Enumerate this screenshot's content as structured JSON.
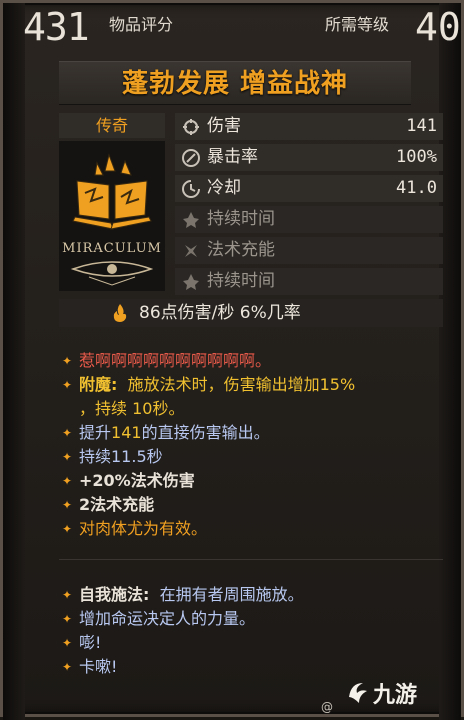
{
  "header": {
    "item_score": "431",
    "item_score_label": "物品评分",
    "required_level_label": "所需等级",
    "required_level": "40"
  },
  "item": {
    "name": "蓬勃发展 增益战神",
    "rarity": "传奇",
    "icon": "spellbook-icon",
    "emblem_text": "MIRACULUM"
  },
  "stats": [
    {
      "icon": "damage-icon",
      "name": "伤害",
      "value": "141"
    },
    {
      "icon": "crit-icon",
      "name": "暴击率",
      "value": "100%"
    },
    {
      "icon": "cooldown-icon",
      "name": "冷却",
      "value": "41.0"
    },
    {
      "icon": "duration-icon",
      "name": "持续时间",
      "value": ""
    },
    {
      "icon": "charges-icon",
      "name": "法术充能",
      "value": ""
    },
    {
      "icon": "duration-icon",
      "name": "持续时间",
      "value": ""
    }
  ],
  "dps": "86点伤害/秒  6%几率",
  "description": [
    {
      "type": "red",
      "text": "惹啊啊啊啊啊啊啊啊啊啊。"
    },
    {
      "type": "enchant",
      "label": "附魔:",
      "text": "施放法术时，伤害输出增加15%"
    },
    {
      "type": "enchant-cont",
      "text": "，持续 10秒。"
    },
    {
      "type": "plain",
      "pre": "提升",
      "num": "141",
      "post": "的直接伤害输出。"
    },
    {
      "type": "blue",
      "text": "持续11.5秒"
    },
    {
      "type": "white",
      "text": "+20%法术伤害"
    },
    {
      "type": "white",
      "text": "2法术充能"
    },
    {
      "type": "orange",
      "text": "对肉体尤为有效。"
    }
  ],
  "aura": [
    {
      "type": "label",
      "label": "自我施法:",
      "text": "在拥有者周围施放。"
    },
    {
      "type": "plain",
      "text": "增加命运决定人的力量。"
    },
    {
      "type": "plain",
      "text": "嘭!"
    },
    {
      "type": "plain",
      "text": "卡嗽!"
    }
  ],
  "watermark": {
    "text": "九游",
    "small": "@"
  },
  "colors": {
    "accent": "#f0a020",
    "red": "#e85a4a",
    "yellow": "#f0c030",
    "blue": "#b8c8f0"
  }
}
